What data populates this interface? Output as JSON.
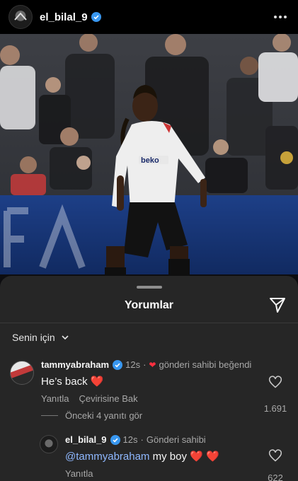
{
  "post": {
    "username": "el_bilal_9"
  },
  "sheet": {
    "title": "Yorumlar",
    "filter_label": "Senin için"
  },
  "comments": [
    {
      "username": "tammyabraham",
      "time": "12s",
      "liked_by_author": "gönderi sahibi beğendi",
      "text": "He’s back ❤️",
      "reply_label": "Yanıtla",
      "translate_label": "Çevirisine Bak",
      "like_count": "1.691"
    }
  ],
  "view_replies": "Önceki 4 yanıtı gör",
  "reply": {
    "username": "el_bilal_9",
    "time": "12s",
    "author_label": "Gönderi sahibi",
    "mention": "@tammyabraham",
    "text": " my boy ❤️ ❤️",
    "reply_label": "Yanıtla",
    "like_count": "622"
  },
  "colors": {
    "verified": "#3897f0",
    "like_red": "#ff3040",
    "sheet_bg": "#262626"
  }
}
